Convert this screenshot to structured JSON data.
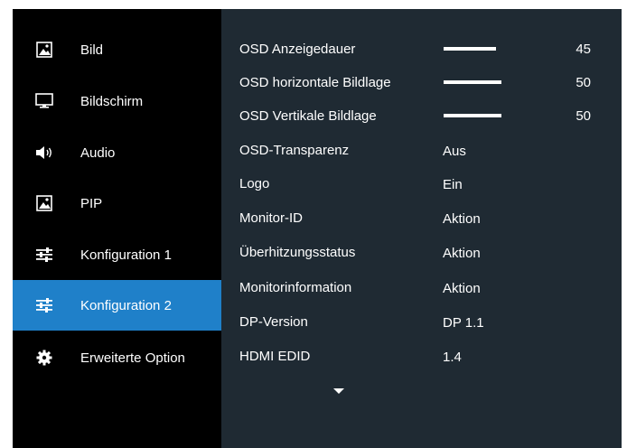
{
  "sidebar": {
    "items": [
      {
        "label": "Bild",
        "icon": "picture-icon",
        "active": false
      },
      {
        "label": "Bildschirm",
        "icon": "monitor-icon",
        "active": false
      },
      {
        "label": "Audio",
        "icon": "speaker-icon",
        "active": false
      },
      {
        "label": "PIP",
        "icon": "picture-icon",
        "active": false
      },
      {
        "label": "Konfiguration 1",
        "icon": "sliders-icon",
        "active": false
      },
      {
        "label": "Konfiguration 2",
        "icon": "sliders-icon",
        "active": true
      },
      {
        "label": "Erweiterte Option",
        "icon": "gear-icon",
        "active": false
      }
    ]
  },
  "settings": [
    {
      "label": "OSD Anzeigedauer",
      "value": "45",
      "level": 0.45
    },
    {
      "label": "OSD horizontale Bildlage",
      "value": "50",
      "level": 0.5
    },
    {
      "label": "OSD Vertikale Bildlage",
      "value": "50",
      "level": 0.5
    },
    {
      "label": "OSD-Transparenz",
      "value": "Aus"
    },
    {
      "label": "Logo",
      "value": "Ein"
    },
    {
      "label": "Monitor-ID",
      "value": "Aktion"
    },
    {
      "label": "Überhitzungsstatus",
      "value": "Aktion"
    },
    {
      "label": "Monitorinformation",
      "value": "Aktion"
    },
    {
      "label": "DP-Version",
      "value": "DP 1.1"
    },
    {
      "label": "HDMI EDID",
      "value": "1.4"
    }
  ],
  "colors": {
    "sidebar_bg": "#000000",
    "active_bg": "#1f80c9",
    "panel_bg": "#1f2a33",
    "text": "#ffffff"
  },
  "scroll_indicator": "chevron-down-icon"
}
